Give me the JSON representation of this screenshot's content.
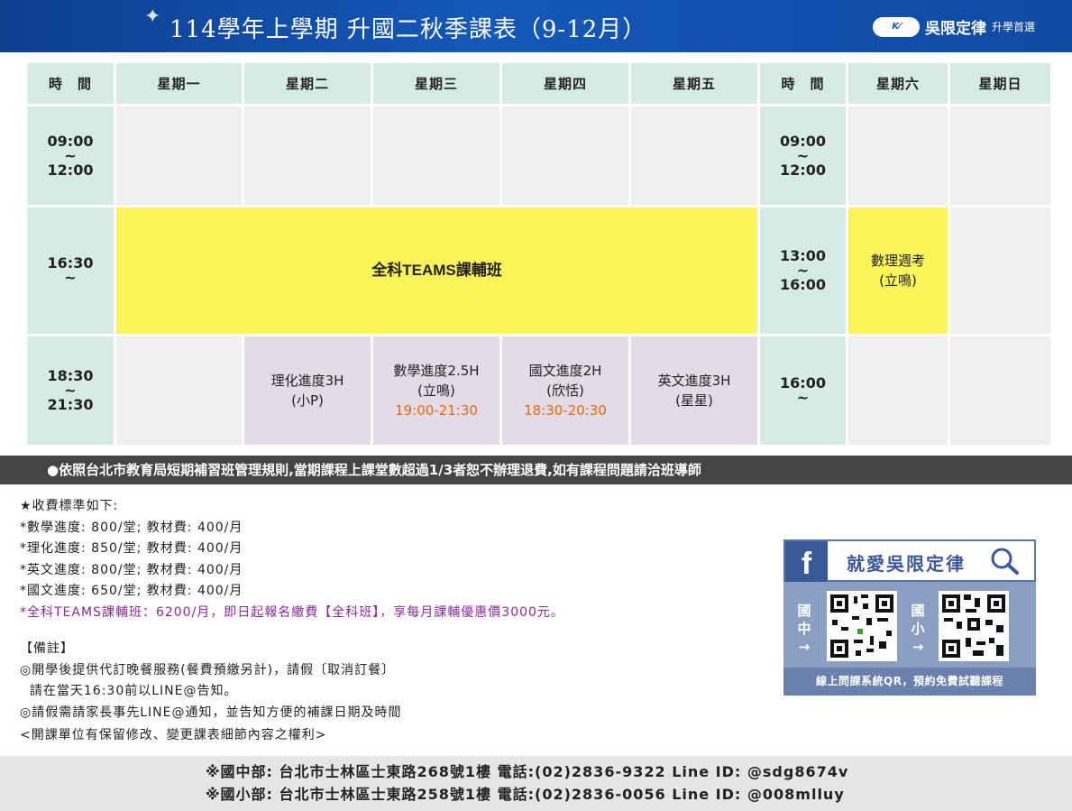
{
  "header": {
    "title": "114學年上學期  升國二秋季課表（9-12月）",
    "brand_name": "吳限定律",
    "brand_slogan": "升學首選"
  },
  "schedule": {
    "headers": [
      "時　間",
      "星期一",
      "星期二",
      "星期三",
      "星期四",
      "星期五",
      "時　間",
      "星期六",
      "星期日"
    ],
    "rows": [
      {
        "weekday_time": {
          "start": "09:00",
          "sep": "~",
          "end": "12:00"
        },
        "weekend_time": {
          "start": "09:00",
          "sep": "~",
          "end": "12:00"
        }
      },
      {
        "weekday_time": {
          "start": "16:30",
          "sep": "~",
          "end": ""
        },
        "teams_class": "全科TEAMS課輔班",
        "weekend_time": {
          "start": "13:00",
          "sep": "~",
          "end": "16:00"
        },
        "saturday": {
          "line1": "數理週考",
          "line2": "(立鳴)"
        }
      },
      {
        "weekday_time": {
          "start": "18:30",
          "sep": "~",
          "end": "21:30"
        },
        "tuesday": {
          "line1": "理化進度3H",
          "line2": "(小P)",
          "time": ""
        },
        "wednesday": {
          "line1": "數學進度2.5H",
          "line2": "(立鳴)",
          "time": "19:00-21:30"
        },
        "thursday": {
          "line1": "國文進度2H",
          "line2": "(欣恬)",
          "time": "18:30-20:30"
        },
        "friday": {
          "line1": "英文進度3H",
          "line2": "(星星)",
          "time": ""
        },
        "weekend_time": {
          "start": "16:00",
          "sep": "~",
          "end": ""
        }
      }
    ]
  },
  "notice": "●依照台北市教育局短期補習班管理規則,當期課程上課堂數超過1/3者恕不辦理退費,如有課程問題請洽班導師",
  "fees": {
    "title": "★收費標準如下:",
    "items": [
      "*數學進度: 800/堂; 教材費: 400/月",
      "*理化進度: 850/堂; 教材費: 400/月",
      "*英文進度: 800/堂; 教材費: 400/月",
      "*國文進度: 650/堂; 教材費: 400/月"
    ],
    "teams": "*全科TEAMS課輔班：6200/月，即日起報名繳費【全科班】，享每月課輔優惠價3000元。",
    "teams_color": "#8a2b9a"
  },
  "remarks": {
    "title": "【備註】",
    "line1": "◎開學後提供代訂晚餐服務(餐費預繳另計)，請假〔取消訂餐〕",
    "line2": "  請在當天16:30前以LINE@告知。",
    "line3": "◎請假需請家長事先LINE@通知，並告知方便的補課日期及時間"
  },
  "rights": "<開課單位有保留修改、變更課表細節內容之權利>",
  "promo": {
    "fb_letter": "f",
    "title": "就愛吳限定律",
    "left_label": [
      "國",
      "中",
      "→"
    ],
    "right_label": [
      "國",
      "小",
      "→"
    ],
    "footer": "線上問課系統QR，預約免費試聽課程"
  },
  "footer": {
    "line1": "※國中部: 台北市士林區士東路268號1樓   電話:(02)2836-9322   Line ID: @sdg8674v",
    "line2": "※國小部: 台北市士林區士東路258號1樓   電話:(02)2836-0056   Line ID: @008mlluy"
  },
  "colors": {
    "header_bg": "#1458b8",
    "time_cell": "#d7ebe5",
    "empty_cell": "#efefef",
    "teams_cell": "#fbf35a",
    "class_cell": "#e3dbe8",
    "time_highlight": "#e8690f"
  }
}
